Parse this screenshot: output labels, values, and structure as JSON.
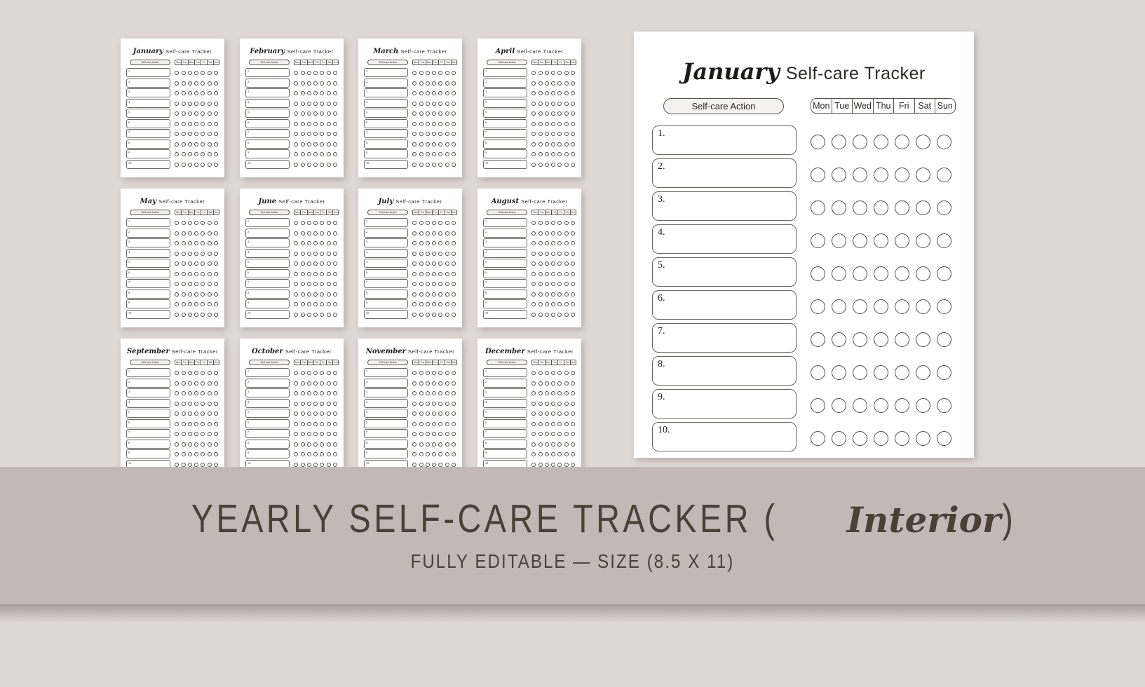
{
  "banner": {
    "title_main": "YEARLY SELF-CARE TRACKER (",
    "title_script": "Interior",
    "title_close": ")",
    "subtitle": "FULLY EDITABLE — SIZE (8.5 X 11)",
    "bg_color": "#c2b8b6",
    "text_color": "#4a4038"
  },
  "page": {
    "background_color": "#dfd8d5"
  },
  "tracker": {
    "subtitle": "Self-care Tracker",
    "action_chip_label": "Self-care Action",
    "days": [
      "Mon",
      "Tue",
      "Wed",
      "Thu",
      "Fri",
      "Sat",
      "Sun"
    ],
    "rows": [
      "1.",
      "2.",
      "3.",
      "4.",
      "5.",
      "6.",
      "7.",
      "8.",
      "9.",
      "10."
    ]
  },
  "main_sheet": {
    "month": "January"
  },
  "thumbnails": [
    {
      "month": "January"
    },
    {
      "month": "February"
    },
    {
      "month": "March"
    },
    {
      "month": "April"
    },
    {
      "month": "May"
    },
    {
      "month": "June"
    },
    {
      "month": "July"
    },
    {
      "month": "August"
    },
    {
      "month": "September"
    },
    {
      "month": "October"
    },
    {
      "month": "November"
    },
    {
      "month": "December"
    }
  ]
}
